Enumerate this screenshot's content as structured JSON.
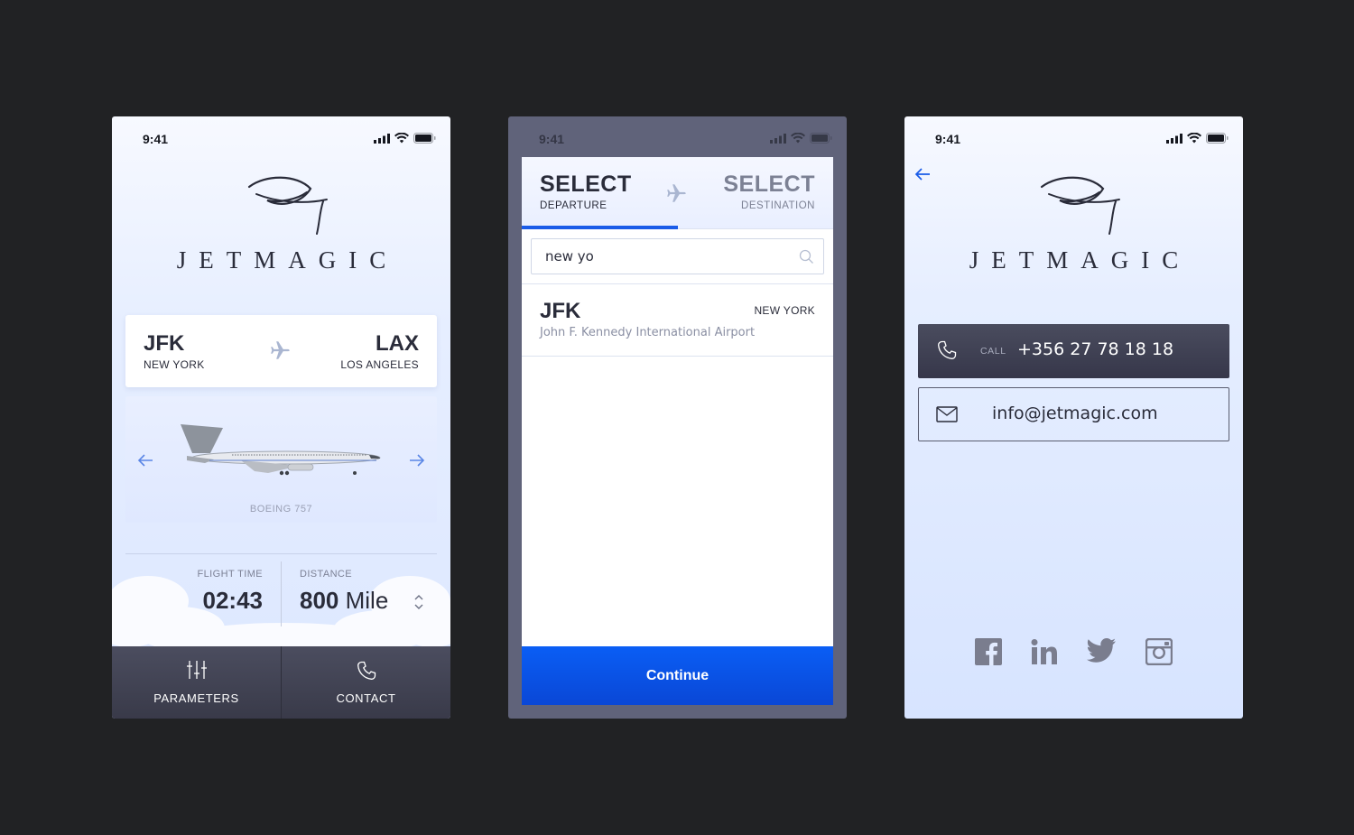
{
  "status_bar": {
    "time": "9:41"
  },
  "brand": {
    "name": "JETMAGIC"
  },
  "screen1": {
    "route": {
      "from_code": "JFK",
      "from_city": "NEW YORK",
      "to_code": "LAX",
      "to_city": "LOS ANGELES"
    },
    "aircraft": {
      "model": "BOEING 757"
    },
    "stats": {
      "flight_time_label": "FLIGHT TIME",
      "flight_time": "02:43",
      "distance_label": "DISTANCE",
      "distance_value": "800",
      "distance_unit": "Mile"
    },
    "tabs": [
      {
        "label": "PARAMETERS",
        "icon": "sliders-icon"
      },
      {
        "label": "CONTACT",
        "icon": "phone-icon"
      }
    ]
  },
  "screen2": {
    "tab_departure": {
      "title": "SELECT",
      "subtitle": "DEPARTURE"
    },
    "tab_destination": {
      "title": "SELECT",
      "subtitle": "DESTINATION"
    },
    "search": {
      "value": "new yo",
      "placeholder": ""
    },
    "results": [
      {
        "code": "JFK",
        "city": "NEW YORK",
        "name": "John F. Kennedy International Airport"
      }
    ],
    "continue_label": "Continue"
  },
  "screen3": {
    "call_label": "CALL",
    "phone": "+356 27 78 18 18",
    "email": "info@jetmagic.com",
    "social": [
      "facebook-icon",
      "linkedin-icon",
      "twitter-icon",
      "instagram-icon"
    ]
  },
  "colors": {
    "accent": "#0a5ef5",
    "dark": "#2a2c3a",
    "bar": "#3f4152"
  }
}
